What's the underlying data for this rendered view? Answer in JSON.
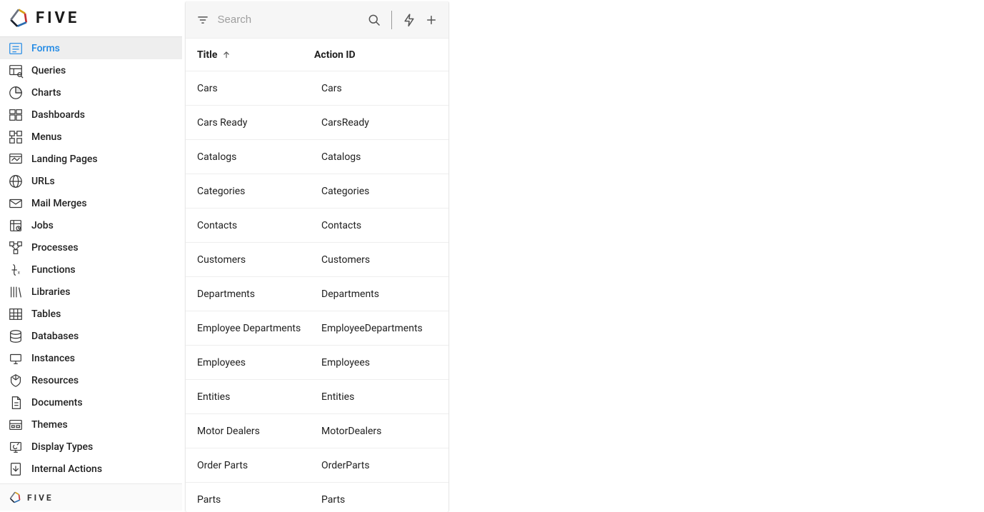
{
  "brand": {
    "name": "FIVE",
    "footer": "FIVE"
  },
  "sidebar": {
    "items": [
      {
        "label": "Forms",
        "icon": "form-icon",
        "active": true
      },
      {
        "label": "Queries",
        "icon": "query-icon"
      },
      {
        "label": "Charts",
        "icon": "chart-icon"
      },
      {
        "label": "Dashboards",
        "icon": "dashboard-icon"
      },
      {
        "label": "Menus",
        "icon": "menu-icon"
      },
      {
        "label": "Landing Pages",
        "icon": "landing-icon"
      },
      {
        "label": "URLs",
        "icon": "globe-icon"
      },
      {
        "label": "Mail Merges",
        "icon": "mail-icon"
      },
      {
        "label": "Jobs",
        "icon": "jobs-icon"
      },
      {
        "label": "Processes",
        "icon": "process-icon"
      },
      {
        "label": "Functions",
        "icon": "function-icon"
      },
      {
        "label": "Libraries",
        "icon": "library-icon"
      },
      {
        "label": "Tables",
        "icon": "table-icon"
      },
      {
        "label": "Databases",
        "icon": "database-icon"
      },
      {
        "label": "Instances",
        "icon": "instance-icon"
      },
      {
        "label": "Resources",
        "icon": "resource-icon"
      },
      {
        "label": "Documents",
        "icon": "document-icon"
      },
      {
        "label": "Themes",
        "icon": "theme-icon"
      },
      {
        "label": "Display Types",
        "icon": "display-icon"
      },
      {
        "label": "Internal Actions",
        "icon": "internal-icon"
      }
    ]
  },
  "toolbar": {
    "search_placeholder": "Search"
  },
  "table": {
    "headers": {
      "title": "Title",
      "action_id": "Action ID"
    },
    "sort": {
      "column": "title",
      "dir": "asc"
    },
    "rows": [
      {
        "title": "Cars",
        "action_id": "Cars"
      },
      {
        "title": "Cars Ready",
        "action_id": "CarsReady"
      },
      {
        "title": "Catalogs",
        "action_id": "Catalogs"
      },
      {
        "title": "Categories",
        "action_id": "Categories"
      },
      {
        "title": "Contacts",
        "action_id": "Contacts"
      },
      {
        "title": "Customers",
        "action_id": "Customers"
      },
      {
        "title": "Departments",
        "action_id": "Departments"
      },
      {
        "title": "Employee Departments",
        "action_id": "EmployeeDepartments"
      },
      {
        "title": "Employees",
        "action_id": "Employees"
      },
      {
        "title": "Entities",
        "action_id": "Entities"
      },
      {
        "title": "Motor Dealers",
        "action_id": "MotorDealers"
      },
      {
        "title": "Order Parts",
        "action_id": "OrderParts"
      },
      {
        "title": "Parts",
        "action_id": "Parts"
      }
    ]
  }
}
